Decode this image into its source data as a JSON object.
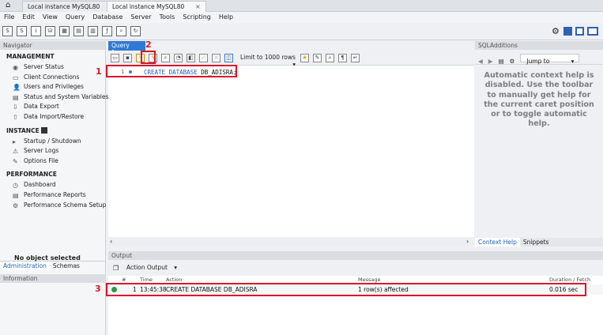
{
  "tabs": [
    {
      "label": "Local instance MySQL80",
      "close": "×"
    },
    {
      "label": "Local instance MySQL80",
      "close": "×"
    }
  ],
  "menu": [
    "File",
    "Edit",
    "View",
    "Query",
    "Database",
    "Server",
    "Tools",
    "Scripting",
    "Help"
  ],
  "navigator": {
    "title": "Navigator",
    "management": {
      "header": "MANAGEMENT",
      "items": [
        "Server Status",
        "Client Connections",
        "Users and Privileges",
        "Status and System Variables",
        "Data Export",
        "Data Import/Restore"
      ]
    },
    "instance": {
      "header": "INSTANCE",
      "items": [
        "Startup / Shutdown",
        "Server Logs",
        "Options File"
      ]
    },
    "performance": {
      "header": "PERFORMANCE",
      "items": [
        "Dashboard",
        "Performance Reports",
        "Performance Schema Setup"
      ]
    },
    "tabs": [
      "Administration",
      "Schemas"
    ],
    "info_title": "Information",
    "info_text": "No object selected"
  },
  "query_tab": {
    "label": "Query 1",
    "close": "×"
  },
  "sql_toolbar": {
    "limit": "Limit to 1000 rows"
  },
  "editor": {
    "line_number": "1",
    "keyword1": "CREATE",
    "keyword2": "DATABASE",
    "identifier": "DB_ADISRA;"
  },
  "sql_additions": {
    "title": "SQLAdditions",
    "jump_to": "Jump to",
    "help_text": "Automatic context help is disabled. Use the toolbar to manually get help for the current caret position or to toggle automatic help.",
    "tabs": [
      "Context Help",
      "Snippets"
    ]
  },
  "output": {
    "title": "Output",
    "selector": "Action Output",
    "columns": [
      "#",
      "Time",
      "Action",
      "Message",
      "Duration / Fetch"
    ],
    "rows": [
      {
        "num": "1",
        "time": "13:45:38",
        "action": "CREATE DATABASE DB_ADISRA",
        "message": "1 row(s) affected",
        "duration": "0.016 sec"
      }
    ]
  },
  "annotations": {
    "one": "1",
    "two": "2",
    "three": "3"
  },
  "colors": {
    "accent": "#2f7ad3",
    "annotation": "#d9142a",
    "success": "#2c9b3c"
  }
}
